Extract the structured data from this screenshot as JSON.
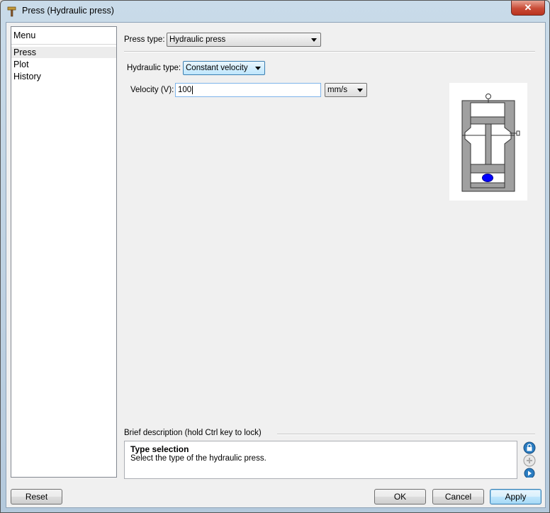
{
  "window": {
    "title": "Press (Hydraulic press)",
    "close_glyph": "✕"
  },
  "sidebar": {
    "header": "Menu",
    "items": [
      {
        "label": "Press",
        "selected": true
      },
      {
        "label": "Plot",
        "selected": false
      },
      {
        "label": "History",
        "selected": false
      }
    ]
  },
  "press_type": {
    "label": "Press type:",
    "value": "Hydraulic press"
  },
  "hydraulic_type": {
    "label": "Hydraulic type:",
    "value": "Constant velocity"
  },
  "velocity": {
    "label": "Velocity (V):",
    "value": "100",
    "unit": "mm/s"
  },
  "description": {
    "group_label": "Brief description (hold Ctrl key to lock)",
    "title": "Type selection",
    "text": "Select the type of the hydraulic press."
  },
  "buttons": {
    "reset": "Reset",
    "ok": "OK",
    "cancel": "Cancel",
    "apply": "Apply"
  },
  "icons": {
    "title": "hammer-icon",
    "lock": "lock-icon",
    "add": "add-icon",
    "next": "next-icon"
  },
  "colors": {
    "accent": "#3c7fb1",
    "diagram_ball": "#0000ff",
    "diagram_body": "#a0a0a0"
  }
}
